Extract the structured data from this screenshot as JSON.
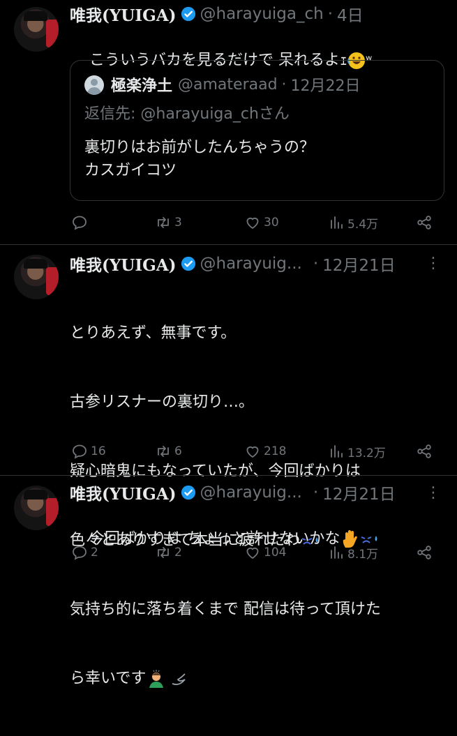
{
  "tweets": [
    {
      "name": "唯我(YUIGA)",
      "handle": "@harayuiga_ch",
      "separator": "·",
      "time": "4日",
      "text": "こういうバカを見るだけで 呆れるよｪ",
      "text_suffix": "ʷ",
      "emojis": [
        "rofl-emoji"
      ],
      "quote": {
        "name": "極楽浄土",
        "handle": "@amateraad",
        "separator": "·",
        "time": "12月22日",
        "reply_to": "返信先: @harayuiga_chさん",
        "text": "裏切りはお前がしたんちゃうの？\nカスガイコツ"
      },
      "replies": "",
      "reposts": "3",
      "likes": "30",
      "views": "5.4万"
    },
    {
      "name": "唯我(YUIGA)",
      "handle": "@harayuig...",
      "separator": "·",
      "time": "12月21日",
      "more": "⋮",
      "text_lines": [
        "とりあえず、無事です。",
        "古参リスナーの裏切り…。",
        "疑心暗鬼にもなっていたが、今回ばかりは",
        "色々とありすぎて本当に疲れたわ",
        "気持ち的に落ち着くまで 配信は待って頂けた",
        "ら幸いです"
      ],
      "emojis": [
        "tired-face-emoji",
        "man-bowing-emoji",
        "dash-emoji"
      ],
      "replies": "16",
      "reposts": "6",
      "likes": "218",
      "views": "13.2万"
    },
    {
      "name": "唯我(YUIGA)",
      "handle": "@harayuig...",
      "separator": "·",
      "time": "12月21日",
      "more": "⋮",
      "text": "今回ばかりは ちょっと許せないかな",
      "emojis": [
        "raised-hand-emoji",
        "tired-face-emoji"
      ],
      "replies": "2",
      "reposts": "2",
      "likes": "104",
      "views": "8.1万"
    }
  ],
  "colors": {
    "background": "#000000",
    "text": "#e7e9ea",
    "muted": "#71767b",
    "divider": "#2f3336",
    "verified": "#1d9bf0"
  },
  "icons": [
    "reply-icon",
    "repost-icon",
    "like-icon",
    "views-icon",
    "share-icon",
    "verified-icon",
    "more-icon"
  ]
}
